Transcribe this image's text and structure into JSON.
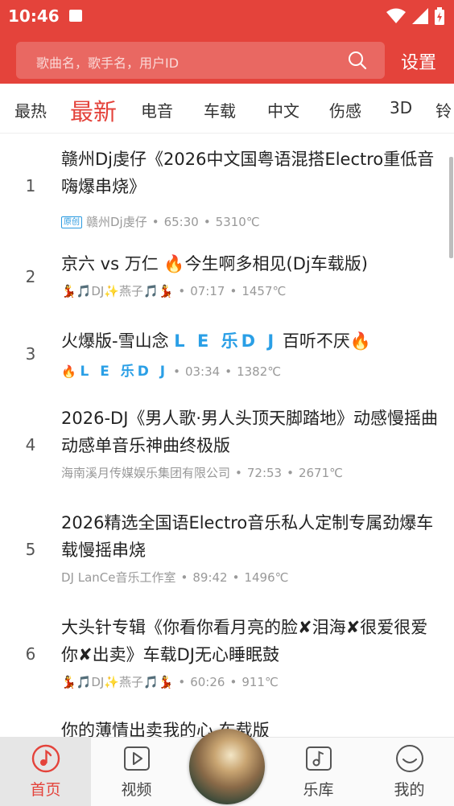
{
  "status_bar": {
    "time": "10:46"
  },
  "header": {
    "search_placeholder": "歌曲名，歌手名，用户ID",
    "settings_label": "设置",
    "brand_color": "#e4433b"
  },
  "tabs": [
    "最热",
    "最新",
    "电音",
    "车载",
    "中文",
    "伤感",
    "3D",
    "铃"
  ],
  "active_tab": "最新",
  "songs": [
    {
      "num": "1",
      "title": "赣州Dj虔仔《2026中文国粤语混搭Electro重低音嗨爆串烧》",
      "tag": "原创",
      "artist": "赣州Dj虔仔",
      "duration": "65:30",
      "heat": "5310℃"
    },
    {
      "num": "2",
      "title": "京六 vs 万仁 🔥今生啊多相见(Dj车载版)",
      "artist": "💃🎵DJ✨燕子🎵💃",
      "duration": "07:17",
      "heat": "1457℃"
    },
    {
      "num": "3",
      "title_prefix": "火爆版-雪山念",
      "title_ledj": "L E 乐D J",
      "title_suffix": "百听不厌🔥",
      "artist_prefix": "🔥",
      "artist_ledj": "L E 乐D J",
      "duration": "03:34",
      "heat": "1382℃"
    },
    {
      "num": "4",
      "title": "2026-DJ《男人歌·男人头顶天脚踏地》动感慢摇曲动感单音乐神曲终极版",
      "artist": "海南溪月传媒娱乐集团有限公司",
      "duration": "72:53",
      "heat": "2671℃"
    },
    {
      "num": "5",
      "title": "2026精选全国语Electro音乐私人定制专属劲爆车载慢摇串烧",
      "artist": "DJ LanCe音乐工作室",
      "duration": "89:42",
      "heat": "1496℃"
    },
    {
      "num": "6",
      "title": "大头针专辑《你看你看月亮的脸✘泪海✘很爱很爱你✘出卖》车载DJ无心睡眠鼓",
      "artist": "💃🎵DJ✨燕子🎵💃",
      "duration": "60:26",
      "heat": "911℃"
    },
    {
      "num": "",
      "title": "你的薄情出卖我的心 车载版"
    }
  ],
  "bottom_nav": [
    "首页",
    "视频",
    "乐库",
    "我的"
  ]
}
